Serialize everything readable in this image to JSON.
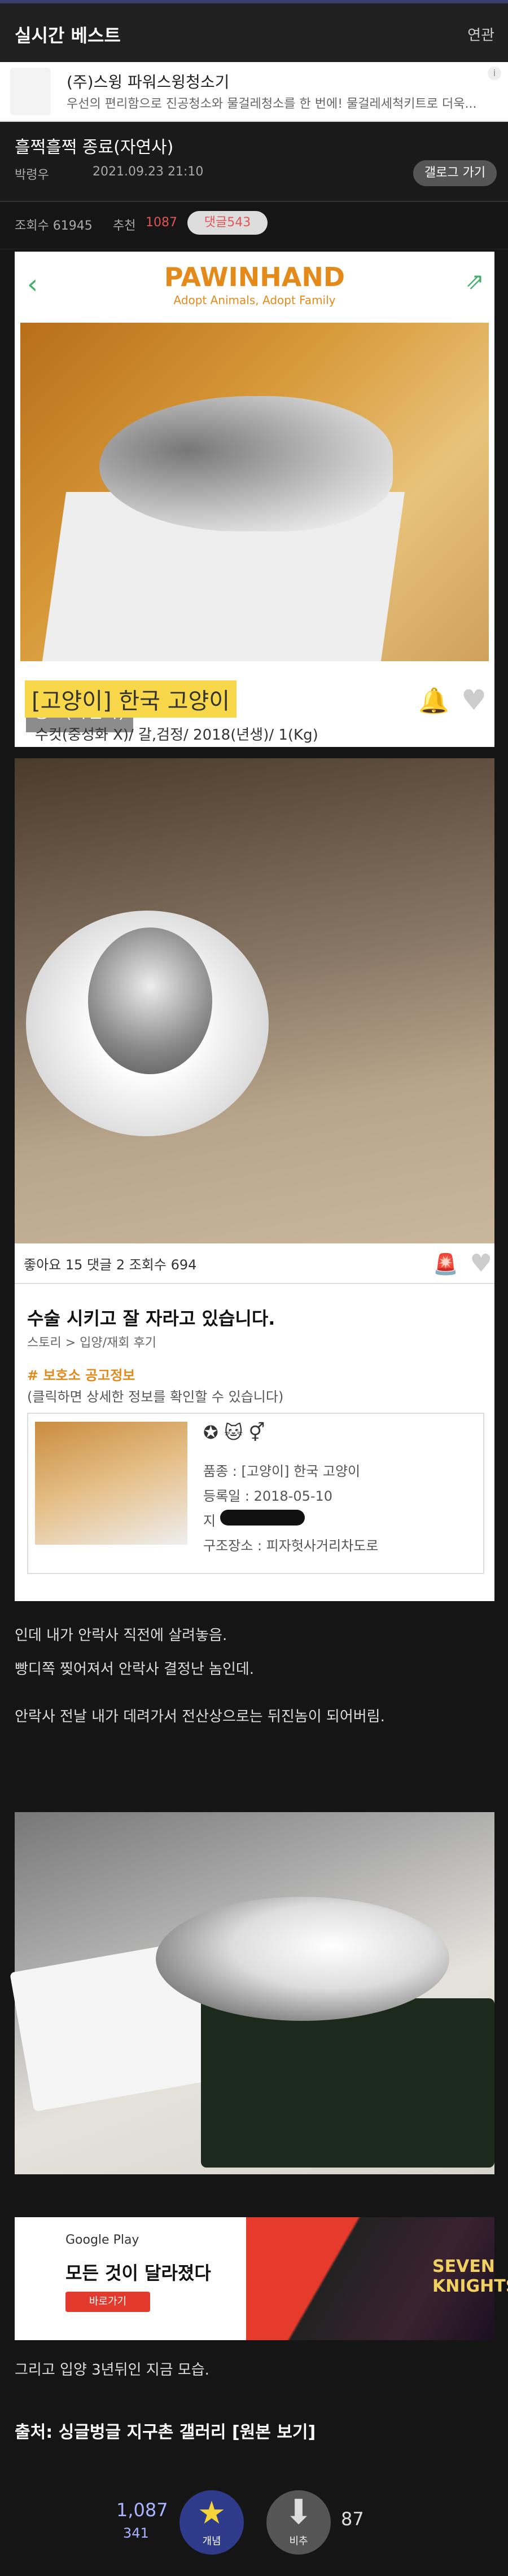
{
  "topbar": {
    "title": "실시간 베스트",
    "right": "연관"
  },
  "ad": {
    "title": "(주)스윙 파워스윙청소기",
    "desc": "우선의 편리함으로 진공청소와 물걸레청소를 한 번에! 물걸레세척키트로 더욱..."
  },
  "post": {
    "title": "흘쩍흘쩍 종료(자연사)",
    "author": "박령우",
    "date": "2021.09.23 21:10",
    "gallery_button": "갤로그 가기",
    "views_label": "조회수 61945",
    "rec_label": "추천",
    "rec_value": "1087",
    "comments": "댓글543"
  },
  "pawinhand": {
    "logo": "PAWINHAND",
    "slogan": "Adopt Animals, Adopt Family",
    "status": "종료(자연사)",
    "animal": "[고양이] 한국 고양이",
    "details": "수컷(중성화 X)/ 갈,검정/ 2018(년생)/ 1(Kg)"
  },
  "story": {
    "stats": "좋아요 15  댓글 2  조회수 694",
    "title": "수술 시키고 잘 자라고 있습니다.",
    "category": "스토리 > 입양/재회 후기",
    "shelter": "# 보호소 공고정보",
    "shelter_hint": "(클릭하면 상세한 정보를 확인할 수 있습니다)",
    "info": {
      "kind": "품종 : [고양이] 한국 고양이",
      "regdate": "등록일 : 2018-05-10",
      "region": "지",
      "location": "구조장소 : 피자헛사거리차도로"
    }
  },
  "body": [
    "인데 내가 안락사 직전에 살려놓음.",
    "빵디쪽 찢어져서 안락사 결정난 놈인데.",
    "안락사 전날 내가 데려가서 전산상으로는 뒤진놈이 되어버림."
  ],
  "gad": {
    "store": "Google Play",
    "headline": "모든 것이 달라졌다",
    "button": "바로가기",
    "brand": "SEVEN KNIGHTS"
  },
  "after": "그리고 입양 3년뒤인 지금 모습.",
  "source": "출처: 싱글벙글 지구촌 갤러리 [원본 보기]",
  "vote": {
    "up_count": "1,087",
    "comment_count": "341",
    "up_label": "개념",
    "down_label": "비추",
    "down_count": "87"
  }
}
